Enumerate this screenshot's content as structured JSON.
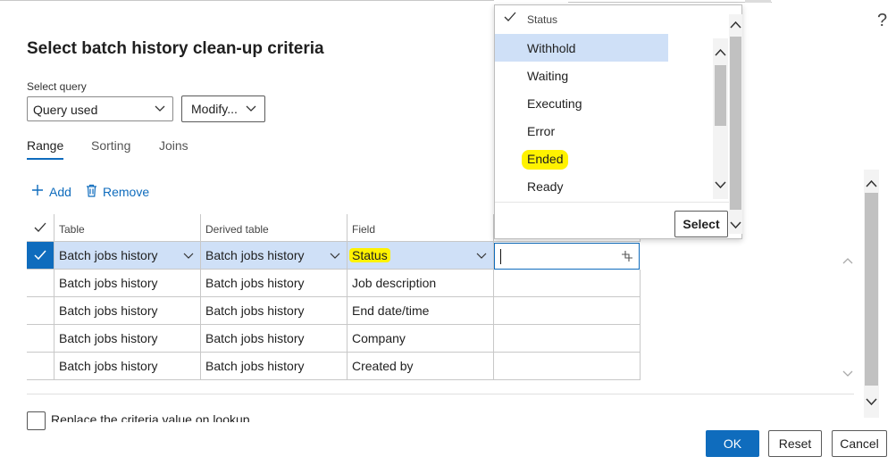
{
  "dialog": {
    "title": "Select batch history clean-up criteria",
    "help_glyph": "?"
  },
  "query": {
    "label": "Select query",
    "value": "Query used",
    "modify_label": "Modify..."
  },
  "tabs": [
    {
      "label": "Range",
      "active": true
    },
    {
      "label": "Sorting",
      "active": false
    },
    {
      "label": "Joins",
      "active": false
    }
  ],
  "actions": {
    "add_label": "Add",
    "remove_label": "Remove"
  },
  "grid": {
    "headers": [
      "Table",
      "Derived table",
      "Field"
    ],
    "rows": [
      {
        "table": "Batch jobs history",
        "derived": "Batch jobs history",
        "field": "Status",
        "selected": true
      },
      {
        "table": "Batch jobs history",
        "derived": "Batch jobs history",
        "field": "Job description",
        "selected": false
      },
      {
        "table": "Batch jobs history",
        "derived": "Batch jobs history",
        "field": "End date/time",
        "selected": false
      },
      {
        "table": "Batch jobs history",
        "derived": "Batch jobs history",
        "field": "Company",
        "selected": false
      },
      {
        "table": "Batch jobs history",
        "derived": "Batch jobs history",
        "field": "Created by",
        "selected": false
      }
    ],
    "criteria_value": ""
  },
  "lookup": {
    "header": "Status",
    "items": [
      "Withhold",
      "Waiting",
      "Executing",
      "Error",
      "Ended",
      "Ready"
    ],
    "selected_item": "Withhold",
    "highlighted_item": "Ended",
    "select_button": "Select"
  },
  "footer": {
    "checkbox_label": "Replace the criteria value on lookup",
    "ok_label": "OK",
    "reset_label": "Reset",
    "cancel_label": "Cancel"
  },
  "colors": {
    "accent": "#0f6cbd",
    "highlight": "#fff200",
    "selected_row": "#cfe0f7"
  }
}
